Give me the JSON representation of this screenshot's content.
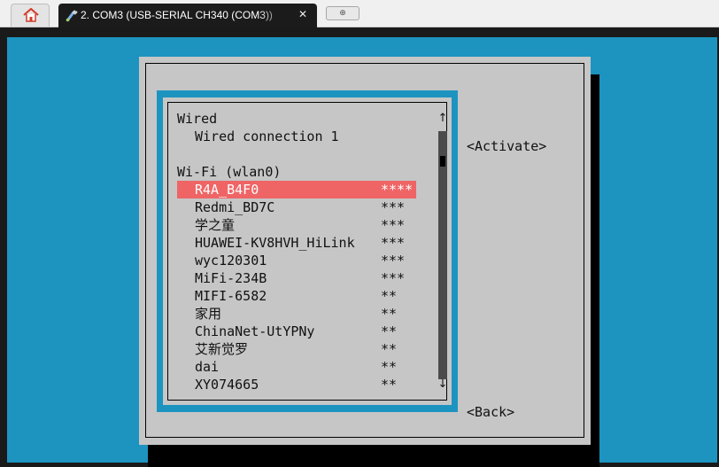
{
  "tabbar": {
    "home_icon": "home-icon",
    "session_tab": {
      "icon": "plug-icon",
      "title": "2. COM3  (USB-SERIAL CH340 (COM3))",
      "close_glyph": "✕"
    },
    "new_tab_glyph": "⊕"
  },
  "dialog": {
    "sections": {
      "wired": {
        "header": "Wired",
        "items": [
          "Wired connection 1"
        ]
      },
      "wifi": {
        "header": "Wi-Fi (wlan0)",
        "selected_index": 0,
        "networks": [
          {
            "name": "R4A_B4F0",
            "signal": "****"
          },
          {
            "name": "Redmi_BD7C",
            "signal": "***"
          },
          {
            "name": "学之童",
            "signal": "***"
          },
          {
            "name": "HUAWEI-KV8HVH_HiLink",
            "signal": "***"
          },
          {
            "name": "wyc120301",
            "signal": "***"
          },
          {
            "name": "MiFi-234B",
            "signal": "***"
          },
          {
            "name": "MIFI-6582",
            "signal": "**"
          },
          {
            "name": "家用",
            "signal": "**"
          },
          {
            "name": "ChinaNet-UtYPNy",
            "signal": "**"
          },
          {
            "name": "艾新觉罗",
            "signal": "**"
          },
          {
            "name": "dai",
            "signal": "**"
          },
          {
            "name": "XY074665",
            "signal": "**"
          }
        ]
      }
    },
    "scrollbar": {
      "up": "↑",
      "down": "↓"
    },
    "buttons": {
      "activate": "<Activate>",
      "back": "<Back>"
    }
  },
  "colors": {
    "terminal_bg": "#1d94c0",
    "dialog_bg": "#c6c6c6",
    "selection": "#ef6566"
  }
}
